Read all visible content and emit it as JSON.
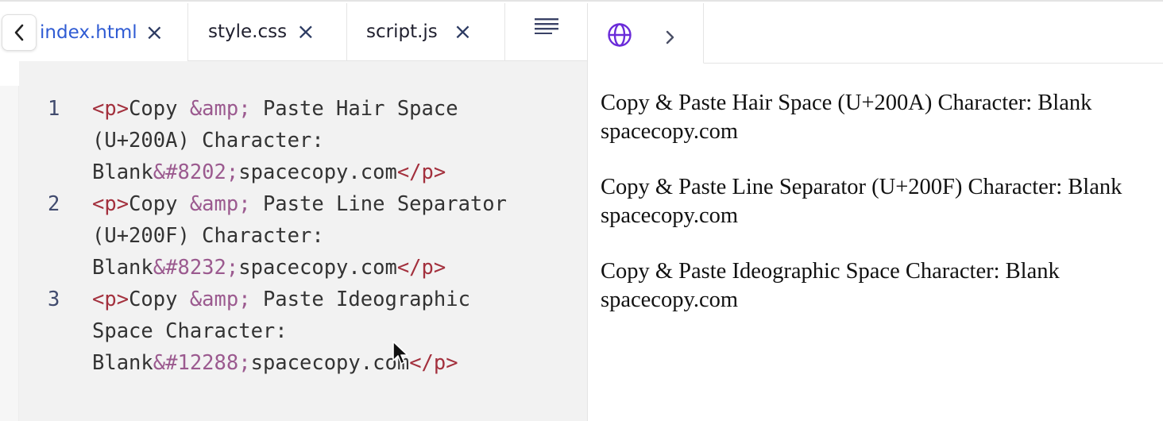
{
  "tabs": [
    {
      "label": "index.html",
      "active": true
    },
    {
      "label": "style.css",
      "active": false
    },
    {
      "label": "script.js",
      "active": false
    }
  ],
  "code": [
    {
      "line_number": "1",
      "parts": [
        {
          "type": "tag",
          "text": "<p>"
        },
        {
          "type": "txt",
          "text": "Copy "
        },
        {
          "type": "ent",
          "text": "&amp;"
        },
        {
          "type": "txt",
          "text": " Paste Hair Space (U+200A) Character: Blank"
        },
        {
          "type": "ent",
          "text": "&#8202;"
        },
        {
          "type": "txt",
          "text": "spacecopy.com"
        },
        {
          "type": "tag",
          "text": "</p>"
        }
      ]
    },
    {
      "line_number": "2",
      "parts": [
        {
          "type": "tag",
          "text": "<p>"
        },
        {
          "type": "txt",
          "text": "Copy "
        },
        {
          "type": "ent",
          "text": "&amp;"
        },
        {
          "type": "txt",
          "text": " Paste Line Separator (U+200F) Character: Blank"
        },
        {
          "type": "ent",
          "text": "&#8232;"
        },
        {
          "type": "txt",
          "text": "spacecopy.com"
        },
        {
          "type": "tag",
          "text": "</p>"
        }
      ]
    },
    {
      "line_number": "3",
      "parts": [
        {
          "type": "tag",
          "text": "<p>"
        },
        {
          "type": "txt",
          "text": "Copy "
        },
        {
          "type": "ent",
          "text": "&amp;"
        },
        {
          "type": "txt",
          "text": " Paste Ideographic Space Character: Blank"
        },
        {
          "type": "ent",
          "text": "&#12288;"
        },
        {
          "type": "txt",
          "text": "spacecopy.com"
        },
        {
          "type": "tag",
          "text": "</p>"
        }
      ]
    }
  ],
  "preview": {
    "paragraphs": [
      "Copy & Paste Hair Space (U+200A) Character: Blank spacecopy.com",
      "Copy & Paste Line Separator (U+200F) Character: Blank spacecopy.com",
      "Copy & Paste Ideographic Space Character: Blank spacecopy.com"
    ]
  },
  "icons": {
    "back": "chevron-left-icon",
    "menu": "text-align-icon",
    "globe": "globe-icon",
    "forward": "chevron-right-icon",
    "close": "close-icon"
  },
  "colors": {
    "active_tab": "#2f5bd3",
    "tag": "#a3303d",
    "entity": "#9b5a8f",
    "globe": "#6a2bd9"
  }
}
